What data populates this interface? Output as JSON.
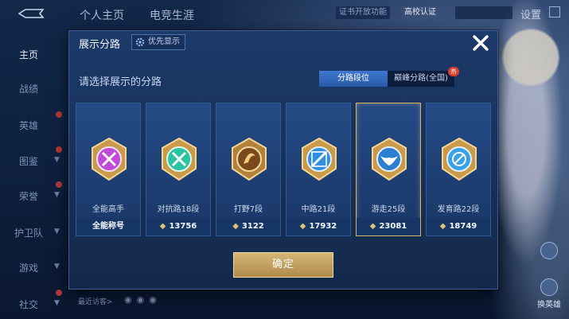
{
  "topbar": {
    "tabs": [
      "个人主页",
      "电竞生涯"
    ],
    "chip_1": "证书开放功能",
    "chip_2": "高校认证",
    "settings_label": "设置"
  },
  "sidebar": {
    "items": [
      "主页",
      "战绩",
      "英雄",
      "图鉴",
      "荣誉",
      "护卫队",
      "游戏",
      "社交"
    ]
  },
  "bottom": {
    "recent_label": "最近访客>"
  },
  "right_buttons": [
    "换英雄"
  ],
  "modal": {
    "title": "展示分路",
    "priority_label": "优先显示",
    "prompt": "请选择展示的分路",
    "toggle": {
      "selected": "分路段位",
      "other": "巅峰分路(全国)"
    },
    "cards": [
      {
        "role": "全能高手",
        "stat": "全能称号",
        "emblem_color": "#c24bd6"
      },
      {
        "role": "对抗路18段",
        "stat": "13756",
        "emblem_color": "#2bc3a0"
      },
      {
        "role": "打野7段",
        "stat": "3122",
        "emblem_color": "#d79a3a"
      },
      {
        "role": "中路21段",
        "stat": "17932",
        "emblem_color": "#2f8fe0"
      },
      {
        "role": "游走25段",
        "stat": "23081",
        "emblem_color": "#2a7fd0"
      },
      {
        "role": "发育路22段",
        "stat": "18749",
        "emblem_color": "#3aa0e8"
      }
    ],
    "selected_card_index": 4,
    "confirm_label": "确定",
    "accent": "#d7b472"
  }
}
